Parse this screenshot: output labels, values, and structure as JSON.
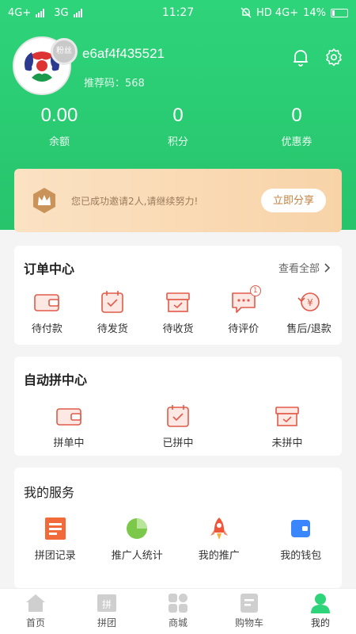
{
  "status_bar": {
    "left_net1": "4G+",
    "left_net2": "3G",
    "time": "11:27",
    "right_network": "HD 4G+",
    "battery": "14%"
  },
  "profile": {
    "fan_badge": "粉丝",
    "username": "e6af4f435521",
    "ref_code": "推荐码：568"
  },
  "stats": [
    {
      "value": "0.00",
      "label": "余额"
    },
    {
      "value": "0",
      "label": "积分"
    },
    {
      "value": "0",
      "label": "优惠券"
    }
  ],
  "invite": {
    "text": "您已成功邀请2人,请继续努力!",
    "button": "立即分享"
  },
  "orders": {
    "title": "订单中心",
    "more": "查看全部",
    "items": [
      {
        "label": "待付款",
        "icon": "wallet-icon"
      },
      {
        "label": "待发货",
        "icon": "calendar-check-icon"
      },
      {
        "label": "待收货",
        "icon": "box-icon"
      },
      {
        "label": "待评价",
        "icon": "chat-icon",
        "badge": "1"
      },
      {
        "label": "售后/退款",
        "icon": "refund-icon"
      }
    ]
  },
  "group": {
    "title": "自动拼中心",
    "items": [
      {
        "label": "拼单中",
        "icon": "wallet-icon"
      },
      {
        "label": "已拼中",
        "icon": "calendar-check-icon"
      },
      {
        "label": "未拼中",
        "icon": "box-icon"
      }
    ]
  },
  "services": {
    "title": "我的服务",
    "items": [
      {
        "label": "拼团记录",
        "icon": "record-icon"
      },
      {
        "label": "推广人统计",
        "icon": "pie-chart-icon"
      },
      {
        "label": "我的推广",
        "icon": "rocket-icon"
      },
      {
        "label": "我的钱包",
        "icon": "wallet-card-icon"
      }
    ]
  },
  "tabbar": [
    {
      "label": "首页",
      "icon": "home-icon"
    },
    {
      "label": "拼团",
      "icon": "group-icon"
    },
    {
      "label": "商城",
      "icon": "grid-icon"
    },
    {
      "label": "购物车",
      "icon": "cart-icon"
    },
    {
      "label": "我的",
      "icon": "user-icon"
    }
  ],
  "colors": {
    "primary": "#2ed47a",
    "accent": "#e05a4a",
    "gold": "#c08040"
  }
}
